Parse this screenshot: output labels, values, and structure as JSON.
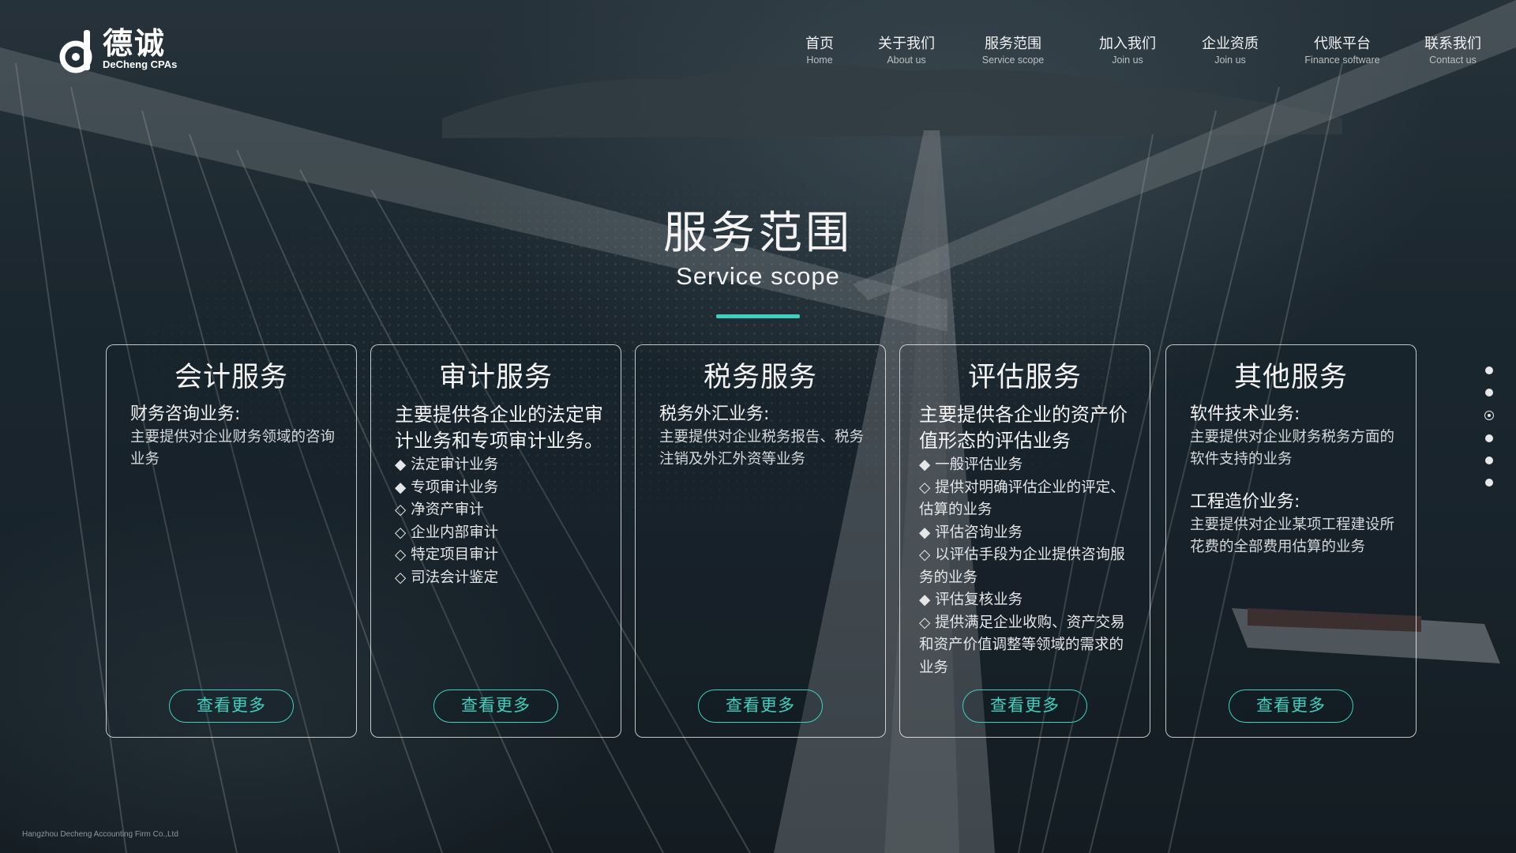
{
  "brand": {
    "name_cn": "德诚",
    "name_en": "DeCheng CPAs",
    "logo_icon": "d-logo-icon"
  },
  "nav": [
    {
      "cn": "首页",
      "en": "Home"
    },
    {
      "cn": "关于我们",
      "en": "About us"
    },
    {
      "cn": "服务范围",
      "en": "Service scope"
    },
    {
      "cn": "加入我们",
      "en": "Join us"
    },
    {
      "cn": "企业资质",
      "en": "Join us"
    },
    {
      "cn": "代账平台",
      "en": "Finance software"
    },
    {
      "cn": "联系我们",
      "en": "Contact us"
    }
  ],
  "heading": {
    "title_cn": "服务范围",
    "title_en": "Service scope",
    "accent_color": "#3fd1bf"
  },
  "cards": [
    {
      "title": "会计服务",
      "sections": [
        {
          "title": "财务咨询业务:",
          "desc": "主要提供对企业财务领域的咨询业务"
        }
      ],
      "button": "查看更多"
    },
    {
      "title": "审计服务",
      "sections": [
        {
          "title": "主要提供各企业的法定审计业务和专项审计业务。"
        }
      ],
      "bullets": [
        "◆ 法定审计业务",
        "◆ 专项审计业务",
        "◇ 净资产审计",
        "◇ 企业内部审计",
        "◇ 特定项目审计",
        "◇ 司法会计鉴定"
      ],
      "button": "查看更多"
    },
    {
      "title": "税务服务",
      "sections": [
        {
          "title": "税务外汇业务:",
          "desc": "主要提供对企业税务报告、税务注销及外汇外资等业务"
        }
      ],
      "button": "查看更多"
    },
    {
      "title": "评估服务",
      "sections": [
        {
          "title": "主要提供各企业的资产价值形态的评估业务"
        }
      ],
      "bullets": [
        "◆ 一般评估业务",
        "◇  提供对明确评估企业的评定、估算的业务",
        "◆ 评估咨询业务",
        "◇ 以评估手段为企业提供咨询服务的业务",
        "◆ 评估复核业务",
        "◇ 提供满足企业收购、资产交易和资产价值调整等领域的需求的业务"
      ],
      "button": "查看更多"
    },
    {
      "title": "其他服务",
      "sections": [
        {
          "title": "软件技术业务:",
          "desc": "主要提供对企业财务税务方面的软件支持的业务"
        },
        {
          "title": "工程造价业务:",
          "desc": "主要提供对企业某项工程建设所花费的全部费用估算的业务"
        }
      ],
      "button": "查看更多"
    }
  ],
  "side_nav": {
    "count": 6,
    "active_index": 2
  },
  "footer": "Hangzhou Decheng Accounting Firm Co.,Ltd"
}
